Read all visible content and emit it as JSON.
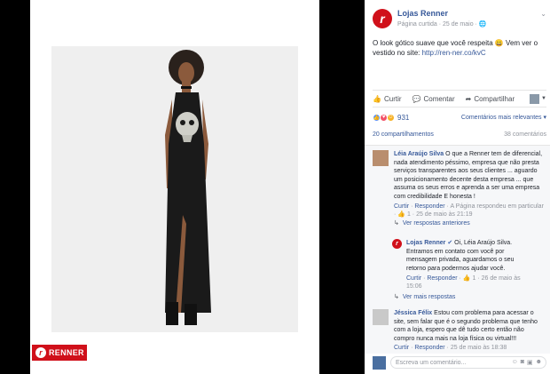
{
  "brand": {
    "tag_label": "RENNER"
  },
  "post": {
    "page_name": "Lojas Renner",
    "meta": "Página curtida · 25 de maio · ",
    "text": "O look gótico suave que você respeita 😀 Vem ver o vestido no site: ",
    "link": "http://ren-ner.co/kvC"
  },
  "actions": {
    "like": "Curtir",
    "comment": "Comentar",
    "share": "Compartilhar"
  },
  "reactions": {
    "count": "931",
    "sort": "Comentários mais relevantes ▾"
  },
  "stats": {
    "shares": "20 compartilhamentos",
    "comments": "38 comentários"
  },
  "comments": [
    {
      "author": "Léia Araújo Silva",
      "text": "O que a Renner tem de diferencial, nada atendimento péssimo, empresa que não presta serviços transparentes aos seus clientes ... aguardo um posicionamento decente desta empresa ... que assuma os seus erros e aprenda a ser uma empresa com credibilidade E honesta !",
      "like": "Curtir",
      "reply": "Responder",
      "meta": " · A Página respondeu em particular · ",
      "reacts": "1",
      "time": " · 25 de maio às 21:19",
      "more_replies": "Ver respostas anteriores"
    },
    {
      "author": "Lojas Renner",
      "text": "Oi, Léia Araújo Silva. Entramos em contato com você por mensagem privada, aguardamos o seu retorno para podermos ajudar você.",
      "like": "Curtir",
      "reply": "Responder",
      "reacts": "1",
      "time": " · 26 de maio às 15:06",
      "more_replies": "Ver mais respostas"
    },
    {
      "author": "Jéssica Félix",
      "text": "Estou com problema para acessar o site, sem falar que é o segundo problema que tenho com a loja, espero que dê tudo certo então não compro nunca mais na loja física ou virtual!!!",
      "like": "Curtir",
      "reply": "Responder",
      "time": " · 25 de maio às 18:38"
    }
  ],
  "composer": {
    "placeholder": "Escreva um comentário..."
  },
  "colors": {
    "brand_red": "#d0101a",
    "link_blue": "#365899"
  }
}
